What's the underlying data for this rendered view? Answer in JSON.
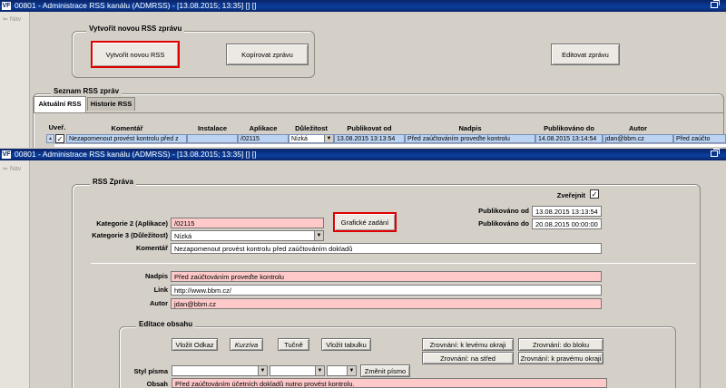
{
  "window1": {
    "title": "00801 - Administrace RSS kanálu (ADMRSS) - [13.08.2015; 13:35] [] []",
    "nav_label": "Nav",
    "group_new": "Vytvořit novou RSS zprávu",
    "btn_create": "Vytvořit novou RSS",
    "btn_copy": "Kopírovat zprávu",
    "btn_edit": "Editovat zprávu",
    "list_label": "Seznam RSS zpráv",
    "tabs": [
      "Aktuální RSS",
      "Historie RSS"
    ],
    "columns": [
      "Uveř.",
      "Komentář",
      "Instalace",
      "Aplikace",
      "Důležitost",
      "Publikovat od",
      "Nadpis",
      "Publikováno do",
      "Autor"
    ],
    "row": {
      "check": "✓",
      "komentar": "Nezapomenout provést kontrolu před z",
      "instalace": "",
      "aplikace": "/02115",
      "dulezitost": "Nízká",
      "publikovat_od": "13.08.2015 13:13:54",
      "nadpis": "Před zaúčtováním proveďte kontrolu",
      "publikovano_do": "14.08.2015 13:14:54",
      "autor": "jdan@bbm.cz",
      "extra": "Před zaúčto"
    }
  },
  "window2": {
    "title": "00801 - Administrace RSS kanálu (ADMRSS) - [13.08.2015; 13:35] [] []",
    "nav_label": "Nav",
    "group_label": "RSS Zpráva",
    "zverejnit_label": "Zveřejnit",
    "zverejnit_check": "✓",
    "pub_od_label": "Publikováno od",
    "pub_od_value": "13.08.2015 13:13:54",
    "pub_do_label": "Publikováno do",
    "pub_do_value": "20.08.2015 00:00:00",
    "kat2_label": "Kategorie 2 (Aplikace)",
    "kat2_value": "/02115",
    "btn_graficke": "Grafické zadání",
    "kat3_label": "Kategorie 3 (Důležitost)",
    "kat3_value": "Nízká",
    "komentar_label": "Komentář",
    "komentar_value": "Nezapomenout provést kontrolu před zaúčtováním dokladů",
    "nadpis_label": "Nadpis",
    "nadpis_value": "Před zaúčtováním proveďte kontrolu",
    "link_label": "Link",
    "link_value": "http://www.bbm.cz/",
    "autor_label": "Autor",
    "autor_value": "jdan@bbm.cz",
    "editace_label": "Editace obsahu",
    "btn_odkaz": "Vložit Odkaz",
    "btn_kurziva": "Kurzíva",
    "btn_tucne": "Tučně",
    "btn_tabulka": "Vložit tabulku",
    "btn_left": "Zrovnání: k levému okraji",
    "btn_block": "Zrovnání: do bloku",
    "btn_center": "Zrovnání: na střed",
    "btn_right": "Zrovnání: k pravému okraji",
    "styl_label": "Styl písma",
    "btn_zmenit": "Změnit písmo",
    "obsah_label": "Obsah",
    "obsah_value": "Před zaúčtováním účetních dokladů nutno provést kontrolu."
  }
}
